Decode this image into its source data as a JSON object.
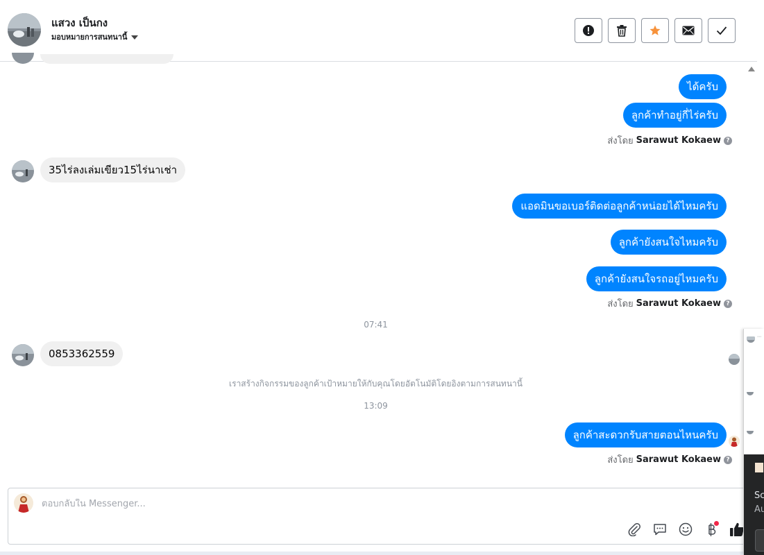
{
  "header": {
    "contact_name": "แสวง เป็นกง",
    "assign_label": "มอบหมายการสนทนานี้",
    "actions": [
      {
        "name": "report-button",
        "icon": "alert-icon"
      },
      {
        "name": "delete-button",
        "icon": "trash-icon"
      },
      {
        "name": "star-button",
        "icon": "star-icon"
      },
      {
        "name": "mark-unread-button",
        "icon": "envelope-icon"
      },
      {
        "name": "done-button",
        "icon": "check-icon"
      }
    ]
  },
  "conversation": {
    "out_1": "ได้ครับ",
    "out_2": "ลูกค้าทำอยู่กี่ไร่ครับ",
    "sent_by_prefix": "ส่งโดย",
    "sent_by_name": "Sarawut Kokaew",
    "in_1": "35ไร่ลงเล่มเขียว15ไร่นาเช่า",
    "out_3": "แอดมินขอเบอร์ติดต่อลูกค้าหน่อยได้ไหมครับ",
    "out_4": "ลูกค้ายังสนใจไหมครับ",
    "out_5": "ลูกค้ายังสนใจรถอยู่ไหมครับ",
    "time_1": "07:41",
    "in_2": "0853362559",
    "system_note": "เราสร้างกิจกรรมของลูกค้าเป้าหมายให้กับคุณโดยอัตโนมัติโดยอิงตามการสนทนานี้",
    "time_2": "13:09",
    "out_6": "ลูกค้าสะดวกรับสายตอนไหนครับ"
  },
  "composer": {
    "placeholder": "ตอบกลับใน Messenger...",
    "tools": [
      "attach-icon",
      "saved-reply-icon",
      "emoji-icon",
      "baht-icon",
      "like-icon"
    ]
  },
  "side_panel": {
    "line_1": "Sc",
    "line_2": "Au"
  },
  "colors": {
    "outgoing": "#0084ff",
    "incoming": "#f0f0f0",
    "star": "#f7923b",
    "badge": "#f02849"
  }
}
